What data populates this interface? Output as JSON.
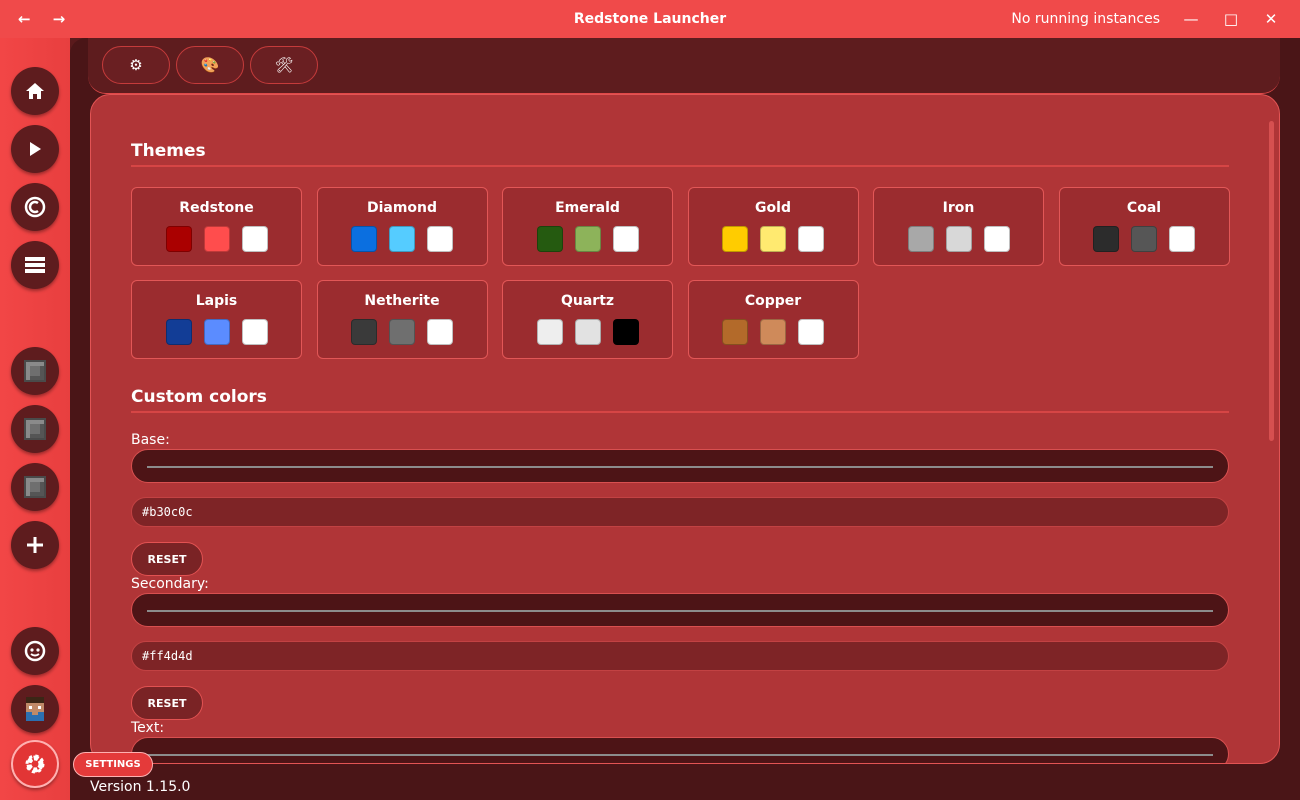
{
  "titlebar": {
    "title": "Redstone Launcher",
    "status": "No running instances",
    "back_icon": "←",
    "forward_icon": "→",
    "minimize": "—",
    "maximize": "□",
    "close": "✕"
  },
  "tabs": [
    {
      "icon": "gear-icon",
      "glyph": "⚙"
    },
    {
      "icon": "palette-icon",
      "glyph": "🎨"
    },
    {
      "icon": "tools-icon",
      "glyph": "🛠"
    }
  ],
  "themes_title": "Themes",
  "themes": [
    {
      "name": "Redstone",
      "colors": [
        "#aa0000",
        "#ff4d4d",
        "#ffffff"
      ]
    },
    {
      "name": "Diamond",
      "colors": [
        "#0b6fe0",
        "#55ccff",
        "#ffffff"
      ]
    },
    {
      "name": "Emerald",
      "colors": [
        "#255a10",
        "#8db35a",
        "#ffffff"
      ]
    },
    {
      "name": "Gold",
      "colors": [
        "#ffcc00",
        "#ffea70",
        "#ffffff"
      ]
    },
    {
      "name": "Iron",
      "colors": [
        "#a8a8a8",
        "#d8d8d8",
        "#ffffff"
      ]
    },
    {
      "name": "Coal",
      "colors": [
        "#2c2c2c",
        "#565656",
        "#ffffff"
      ]
    },
    {
      "name": "Lapis",
      "colors": [
        "#123d96",
        "#5b8cff",
        "#ffffff"
      ]
    },
    {
      "name": "Netherite",
      "colors": [
        "#3a3a3a",
        "#6f6f6f",
        "#ffffff"
      ]
    },
    {
      "name": "Quartz",
      "colors": [
        "#eeeeee",
        "#e2e2e2",
        "#000000"
      ]
    },
    {
      "name": "Copper",
      "colors": [
        "#b36a2a",
        "#cf8a5a",
        "#ffffff"
      ]
    }
  ],
  "custom_title": "Custom colors",
  "fields": [
    {
      "label": "Base:",
      "value": "#b30c0c",
      "reset": "RESET"
    },
    {
      "label": "Secondary:",
      "value": "#ff4d4d",
      "reset": "RESET"
    },
    {
      "label": "Text:"
    }
  ],
  "settings_label": "SETTINGS",
  "version": "Version 1.15.0",
  "colors": {
    "titlebar": "#f04a4a",
    "panel": "#b03537",
    "accent": "#e23535"
  }
}
